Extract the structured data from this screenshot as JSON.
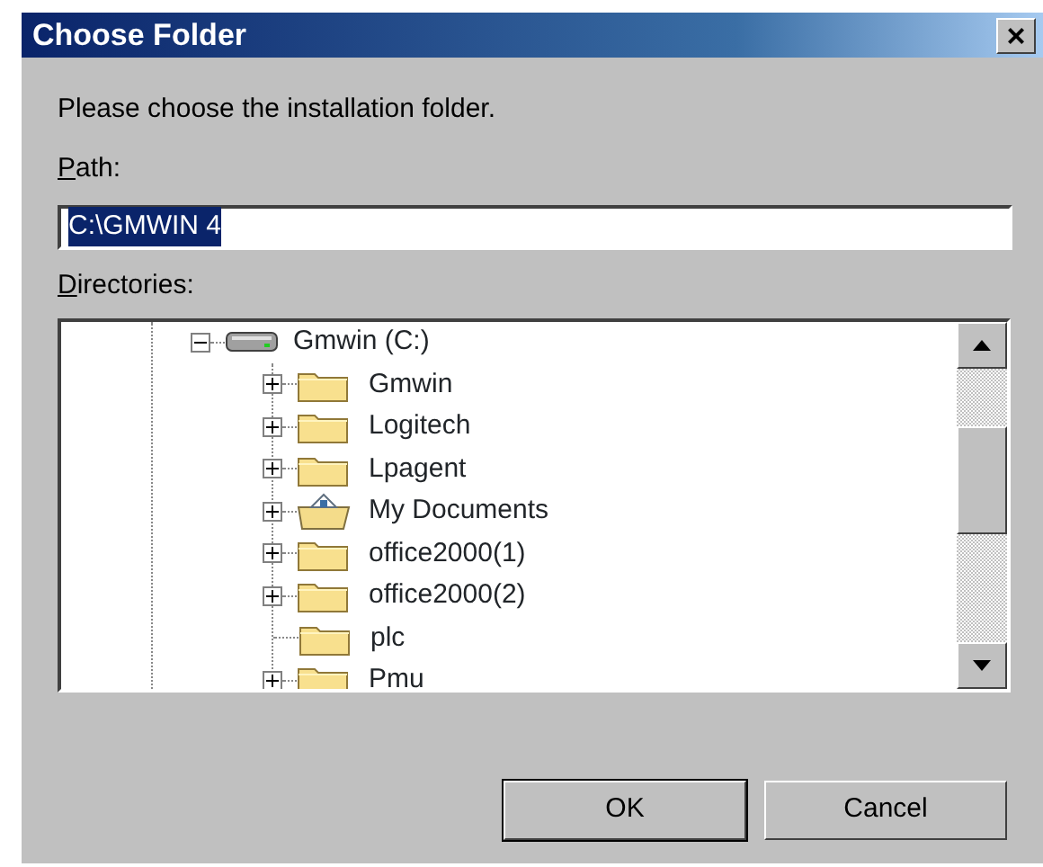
{
  "window": {
    "title": "Choose Folder",
    "close": "×"
  },
  "prompt": "Please choose the installation folder.",
  "path": {
    "label": "Path:",
    "value": "C:\\GMWIN 4",
    "selected": true
  },
  "directories": {
    "label": "Directories:",
    "tree": [
      {
        "label": "Gmwin (C:)",
        "kind": "drive",
        "expanded": true,
        "children": [
          {
            "label": "Gmwin",
            "kind": "folder",
            "expanded": false
          },
          {
            "label": "Logitech",
            "kind": "folder",
            "expanded": false
          },
          {
            "label": "Lpagent",
            "kind": "folder",
            "expanded": false
          },
          {
            "label": "My Documents",
            "kind": "documents",
            "expanded": false
          },
          {
            "label": "office2000(1)",
            "kind": "folder",
            "expanded": false
          },
          {
            "label": "office2000(2)",
            "kind": "folder",
            "expanded": false
          },
          {
            "label": "plc",
            "kind": "folder"
          },
          {
            "label": "Pmu",
            "kind": "folder",
            "expanded": false
          }
        ]
      }
    ]
  },
  "buttons": [
    {
      "label": "OK",
      "default": true
    },
    {
      "label": "Cancel",
      "default": false
    }
  ]
}
